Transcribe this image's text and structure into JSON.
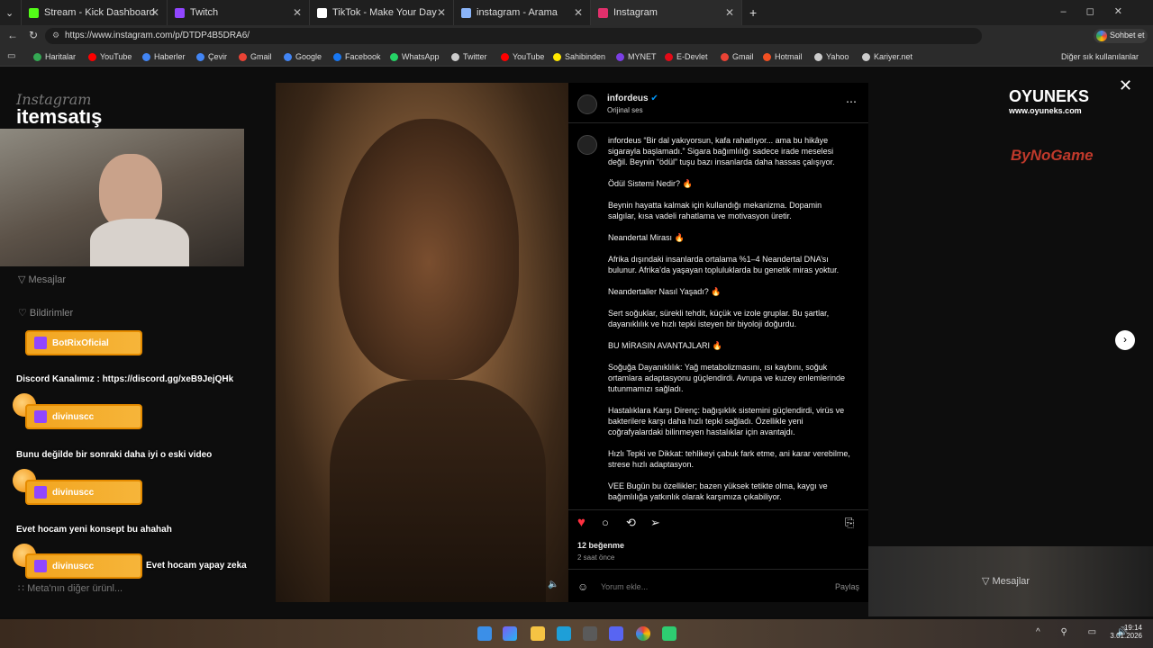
{
  "tabs": [
    {
      "label": "Stream - Kick Dashboard",
      "color": "#53fc18"
    },
    {
      "label": "Twitch",
      "color": "#9146ff"
    },
    {
      "label": "TikTok - Make Your Day",
      "color": "#ffffff"
    },
    {
      "label": "instagram - Arama",
      "color": "#8ab4f8"
    },
    {
      "label": "Instagram",
      "color": "#e1306c"
    }
  ],
  "address": {
    "url": "https://www.instagram.com/p/DTDP4B5DRA6/",
    "chat_label": "Sohbet et"
  },
  "bookmarks": [
    {
      "label": "Haritalar",
      "color": "#34a853"
    },
    {
      "label": "YouTube",
      "color": "#ff0000"
    },
    {
      "label": "Haberler",
      "color": "#4285f4"
    },
    {
      "label": "Çevir",
      "color": "#4285f4"
    },
    {
      "label": "Gmail",
      "color": "#ea4335"
    },
    {
      "label": "Google",
      "color": "#4285f4"
    },
    {
      "label": "Facebook",
      "color": "#1877f2"
    },
    {
      "label": "WhatsApp",
      "color": "#25d366"
    },
    {
      "label": "Twitter",
      "color": "#cccccc"
    },
    {
      "label": "YouTube",
      "color": "#ff0000"
    },
    {
      "label": "Sahibinden",
      "color": "#ffe800"
    },
    {
      "label": "MYNET",
      "color": "#7b3fe4"
    },
    {
      "label": "E-Devlet",
      "color": "#e30a17"
    },
    {
      "label": "Gmail",
      "color": "#ea4335"
    },
    {
      "label": "Hotmail",
      "color": "#f25022"
    },
    {
      "label": "Yahoo",
      "color": "#cccccc"
    },
    {
      "label": "Kariyer.net",
      "color": "#cccccc"
    }
  ],
  "other_bookmarks": "Diğer sık kullanılanlar",
  "sidebar": {
    "instagram_logo": "Instagram",
    "brand": "itemsatış",
    "messages": "Mesajlar",
    "notifications": "Bildirimler",
    "more": "Meta'nın diğer ürünl..."
  },
  "overlays": {
    "bot_name": "BotRixOficial",
    "discord": "Discord Kanalımız : https://discord.gg/xeB9JejQHk",
    "user1": "divinuscc",
    "msg1": "Bunu değilde bir sonraki daha iyi o eski video",
    "user2": "divinuscc",
    "msg2": "Evet hocam yeni konsept bu ahahah",
    "user3": "divinuscc",
    "msg3": "Evet hocam yapay zeka",
    "sponsor1": "OYUNEKS",
    "sponsor1_url": "www.oyuneks.com",
    "sponsor2": "ByNoGame"
  },
  "post": {
    "username": "infordeus",
    "audio": "Orijinal ses",
    "caption": [
      "infordeus “Bir dal yakıyorsun, kafa rahatlıyor... ama bu hikâye sigarayla başlamadı.” Sigara bağımlılığı sadece irade meselesi değil. Beynin “ödül” tuşu bazı insanlarda daha hassas çalışıyor.",
      "Ödül Sistemi Nedir? 🔥",
      "Beynin hayatta kalmak için kullandığı mekanizma. Dopamin salgılar, kısa vadeli rahatlama ve motivasyon üretir.",
      "Neandertal Mirası 🔥",
      "Afrika dışındaki insanlarda ortalama %1–4 Neandertal DNA’sı bulunur. Afrika’da yaşayan topluluklarda bu genetik miras yoktur.",
      "Neandertaller Nasıl Yaşadı? 🔥",
      "Sert soğuklar, sürekli tehdit, küçük ve izole gruplar. Bu şartlar, dayanıklılık ve hızlı tepki isteyen bir biyoloji doğurdu.",
      "BU MİRASIN AVANTAJLARI 🔥",
      "Soğuğa Dayanıklılık: Yağ metabolizmasını, ısı kaybını, soğuk ortamlara adaptasyonu güçlendirdi. Avrupa ve kuzey enlemlerinde tutunmamızı sağladı.",
      "Hastalıklara Karşı Direnç: bağışıklık sistemini güçlendirdi, virüs ve bakterilere karşı daha hızlı tepki sağladı. Özellikle yeni coğrafyalardaki bilinmeyen hastalıklar için avantajdı.",
      "Hızlı Tepki ve Dikkat: tehlikeyi çabuk fark etme, ani karar verebilme, strese hızlı adaptasyon.",
      "VEE Bugün bu özellikler; bazen yüksek tetikte olma, kaygı ve bağımlılığa yatkınlık olarak karşımıza çıkabiliyor."
    ],
    "likes": "12 beğenme",
    "time": "2 saat önce",
    "comment_placeholder": "Yorum ekle...",
    "share": "Paylaş",
    "like_color": "#ff3040"
  },
  "right_chat": "Mesajlar",
  "clock": {
    "time": "19:14",
    "date": "3.01.2026"
  }
}
